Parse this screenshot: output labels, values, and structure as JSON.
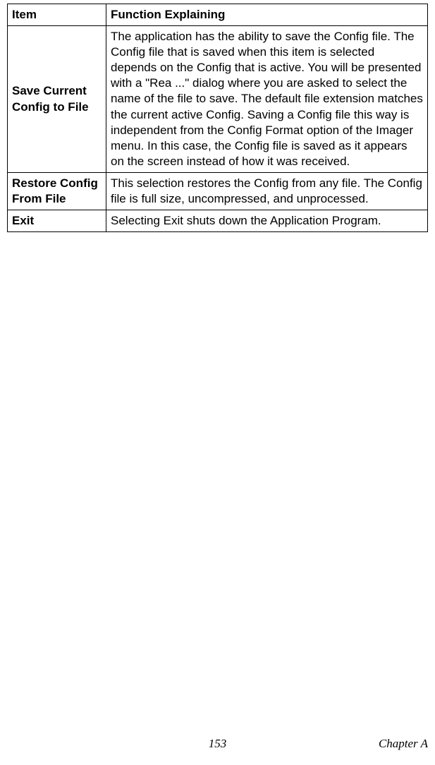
{
  "table": {
    "header": {
      "item": "Item",
      "func": "Function Explaining"
    },
    "rows": [
      {
        "item": "Save Current Config to File",
        "func": "The application has the ability to save the Config file. The Config file that is saved when this item is selected depends on the Config that is active. You will be presented with a \"Rea ...\" dialog where you are asked to select the name of the file to save. The default file extension matches the current active Config. Saving a Config file this way is independent from the Config Format option of the Imager menu. In this case, the Config file is saved as it appears on the screen instead of how it was received."
      },
      {
        "item": "Restore Config From File",
        "func": "This selection restores the Config from any file. The Config file is full size, uncompressed, and unprocessed."
      },
      {
        "item": "Exit",
        "func": "Selecting Exit shuts down the Application Program."
      }
    ]
  },
  "footer": {
    "page": "153",
    "chapter": "Chapter A"
  }
}
